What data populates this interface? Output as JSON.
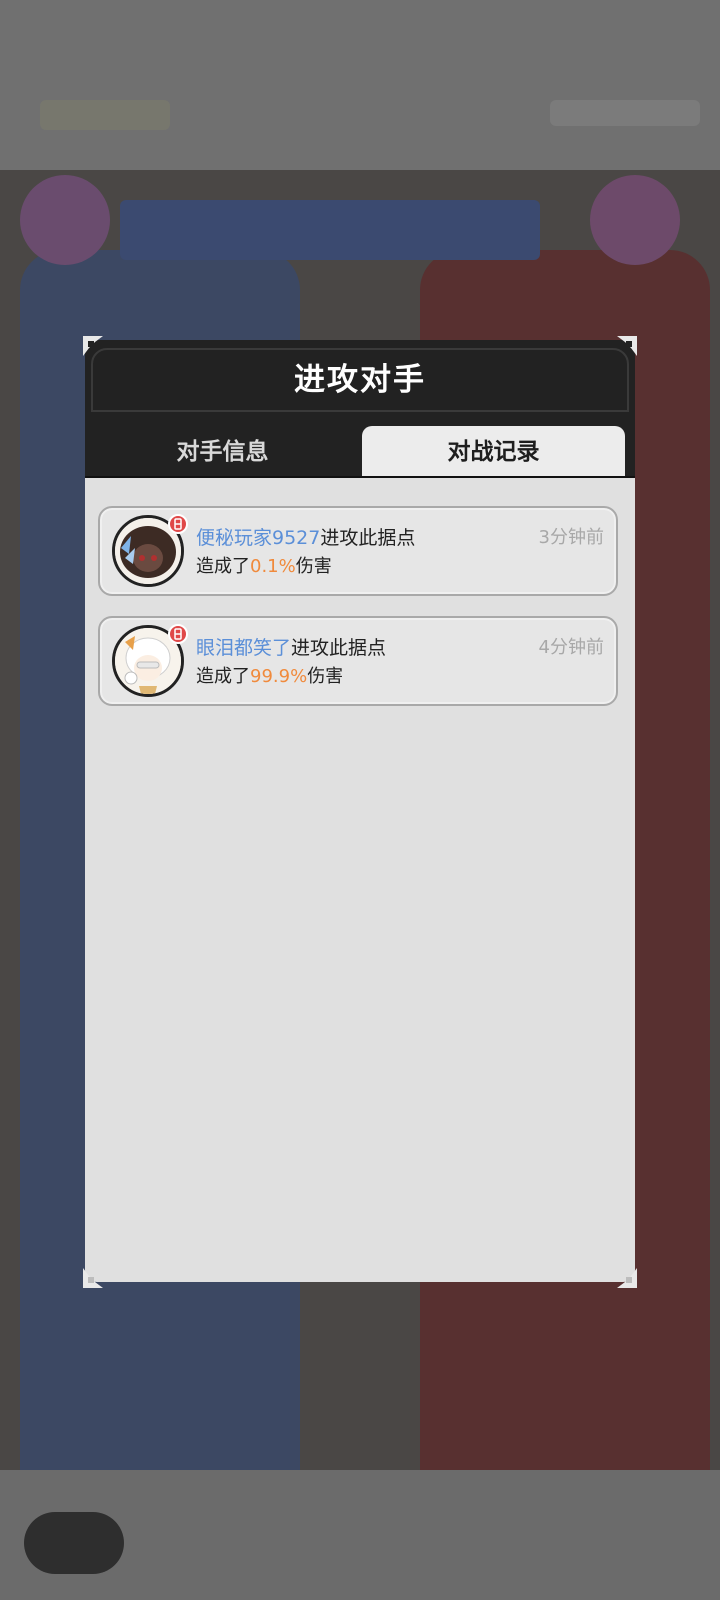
{
  "dialog": {
    "title": "进攻对手",
    "tabs": [
      {
        "label": "对手信息",
        "active": false
      },
      {
        "label": "对战记录",
        "active": true
      }
    ]
  },
  "records": [
    {
      "player_name": "便秘玩家9527",
      "action": "进攻此据点",
      "damage_prefix": "造成了",
      "damage_percent": "0.1%",
      "damage_suffix": "伤害",
      "time_ago": "3分钟前",
      "avatar_icon": "dark-haired-character-avatar-icon",
      "badge_icon": "level-badge-icon"
    },
    {
      "player_name": "眼泪都笑了",
      "action": "进攻此据点",
      "damage_prefix": "造成了",
      "damage_percent": "99.9%",
      "damage_suffix": "伤害",
      "time_ago": "4分钟前",
      "avatar_icon": "white-haired-character-avatar-icon",
      "badge_icon": "level-badge-icon"
    }
  ],
  "colors": {
    "player_name": "#5b8fd8",
    "damage_percent": "#f08a3c",
    "time": "#a8a8a8",
    "header_bg": "#222222",
    "body_bg": "#e0e0e0"
  }
}
